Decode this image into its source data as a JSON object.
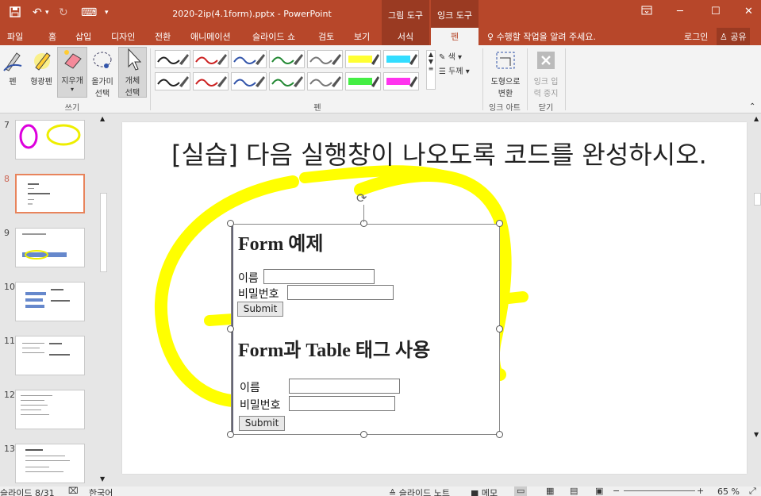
{
  "window": {
    "title": "2020-2ip(4.1form).pptx - PowerPoint",
    "context_group_picture": "그림 도구",
    "context_group_ink": "잉크 도구",
    "restore_icon": "□",
    "min": "─",
    "max": "☐",
    "close": "✕",
    "qat_undo": "↶",
    "qat_redo": "↻",
    "qat_save": "save-icon",
    "qat_more": "▾",
    "qat_slideshow": "⌨"
  },
  "tabs": [
    "파일",
    "홈",
    "삽입",
    "디자인",
    "전환",
    "애니메이션",
    "슬라이드 쇼",
    "검토",
    "보기",
    "서식",
    "펜"
  ],
  "tellme": "수행할 작업을 알려 주세요.",
  "signin": "로그인",
  "share": "공유",
  "ribbon": {
    "pen": "펜",
    "highlighter": "형광펜",
    "eraser": "지우개",
    "lasso_l1": "올가미",
    "lasso_l2": "선택",
    "object_l1": "개체",
    "object_l2": "선택",
    "color": "색",
    "thickness": "두께",
    "convert_l1": "도형으로",
    "convert_l2": "변환",
    "stop_l1": "잉크 입",
    "stop_l2": "력 중지",
    "groups": {
      "write": "쓰기",
      "pens": "펜",
      "ink_art": "잉크 아트",
      "close": "닫기"
    },
    "pen_colors_row1": [
      "#222222",
      "#cc2222",
      "#3355aa",
      "#228833",
      "#777777",
      "#ffff33",
      "#33ddff"
    ],
    "pen_colors_row2": [
      "#222222",
      "#cc2222",
      "#3355aa",
      "#228833",
      "#777777",
      "#44ee44",
      "#ff33ee"
    ]
  },
  "thumbnails": [
    {
      "num": "7"
    },
    {
      "num": "8"
    },
    {
      "num": "9"
    },
    {
      "num": "10"
    },
    {
      "num": "11"
    },
    {
      "num": "12"
    },
    {
      "num": "13"
    }
  ],
  "slide": {
    "heading": "[실습] 다음 실행창이 나오도록 코드를 완성하시오.",
    "form_example_title": "Form 예제",
    "name_label": "이름",
    "password_label": "비밀번호",
    "submit": "Submit",
    "table_title": "Form과 Table 태그 사용",
    "name_label2": "이름",
    "password_label2": "비밀번호",
    "submit2": "Submit"
  },
  "status": {
    "slide": "슬라이드 8/31",
    "lang": "한국어",
    "notes": "슬라이드 노트",
    "comments": "메모",
    "zoom": "65 %"
  },
  "colors": {
    "accent": "#b7472a",
    "highlight": "#ffff00"
  }
}
